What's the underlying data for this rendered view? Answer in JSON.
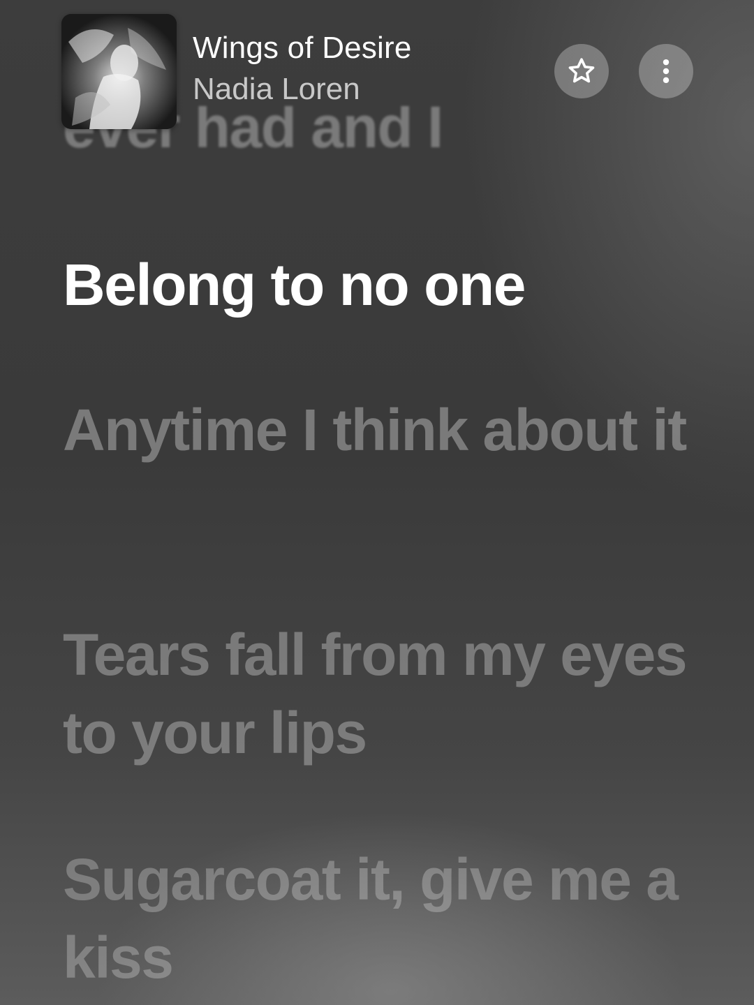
{
  "now_playing": {
    "title": "Wings of Desire",
    "artist": "Nadia Loren",
    "favorite_icon": "star-icon",
    "more_icon": "more-vertical-icon"
  },
  "lyrics": {
    "previous_line": "ever had and I",
    "current_line": "Belong to no one",
    "upcoming_lines": [
      "Anytime I think about it",
      "Tears fall from my eyes to your lips",
      "Sugarcoat it, give me a kiss"
    ]
  },
  "colors": {
    "background": "#3d3d3d",
    "active_lyric": "#ffffff",
    "inactive_lyric": "#7a7a7a"
  }
}
